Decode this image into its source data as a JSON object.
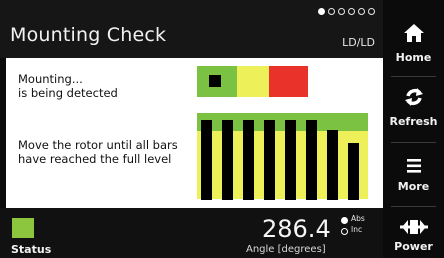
{
  "header": {
    "title": "Mounting Check",
    "mode": "LD/LD",
    "page_dots": 6,
    "active_dot": 0
  },
  "main": {
    "detect_line1": "Mounting...",
    "detect_line2": "is being detected",
    "instruction_line1": "Move the rotor until all bars",
    "instruction_line2": "have reached the full level",
    "indicator": {
      "zones": [
        "green",
        "yellow",
        "red"
      ],
      "colors": {
        "green": "#7cc242",
        "yellow": "#eef05a",
        "red": "#e8322a"
      },
      "active_zone": "green"
    },
    "bar_levels": [
      1.0,
      1.0,
      1.0,
      1.0,
      1.0,
      1.0,
      0.88,
      0.71
    ]
  },
  "sidebar": {
    "items": [
      {
        "label": "Home",
        "icon": "home-icon"
      },
      {
        "label": "Refresh",
        "icon": "refresh-icon"
      },
      {
        "label": "More",
        "icon": "menu-icon"
      },
      {
        "label": "Power",
        "icon": "power-icon"
      }
    ]
  },
  "status": {
    "label": "Status",
    "color": "#8cc63f",
    "value": "286.4",
    "unit": "Angle [degrees]",
    "abs_label": "Abs",
    "inc_label": "Inc",
    "selected": "Abs"
  }
}
